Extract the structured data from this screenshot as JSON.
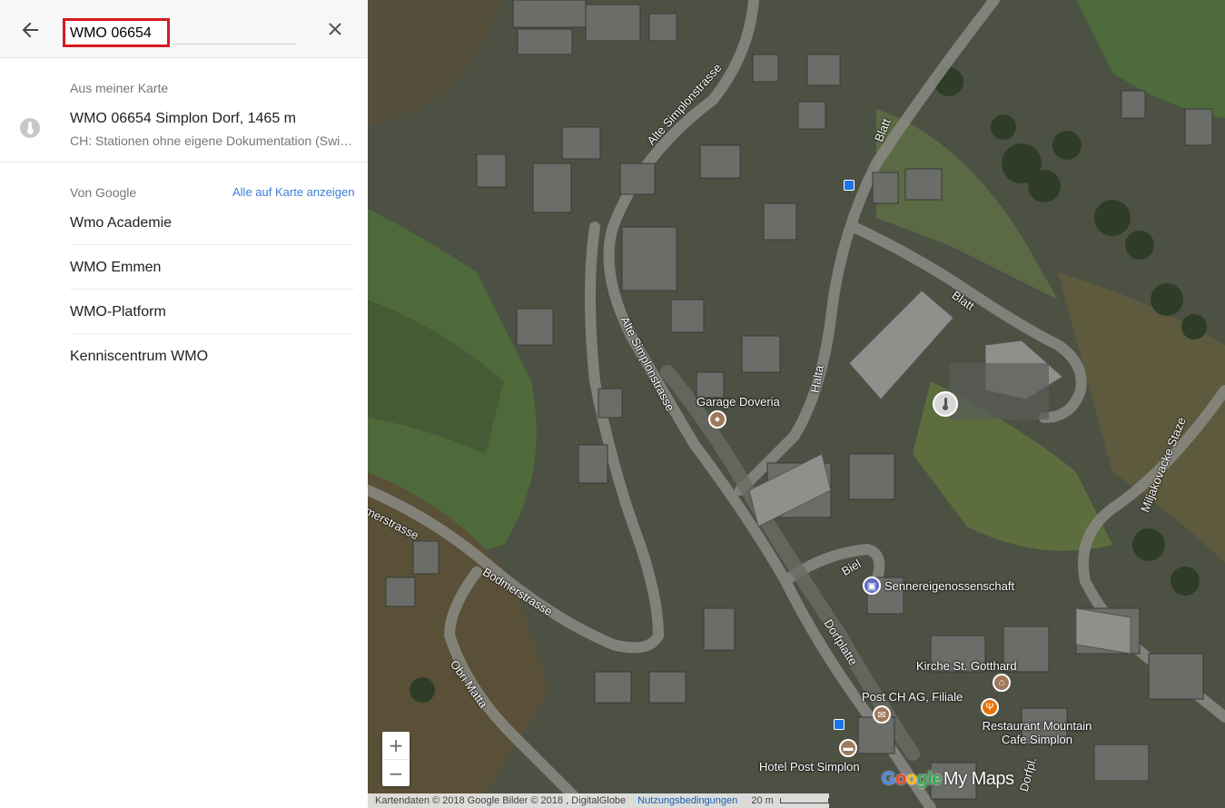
{
  "search": {
    "query": "WMO 06654",
    "back_icon": "arrow-left-icon",
    "close_icon": "close-icon"
  },
  "my_map": {
    "section_label": "Aus meiner Karte",
    "result_title": "WMO 06654 Simplon Dorf, 1465 m",
    "result_subtitle": "CH: Stationen ohne eigene Dokumentation (Swis…",
    "result_icon": "thermometer-icon"
  },
  "google": {
    "section_label": "Von Google",
    "show_all_link": "Alle auf Karte anzeigen",
    "results": [
      "Wmo Academie",
      "WMO Emmen",
      "WMO-Platform",
      "Kenniscentrum WMO"
    ]
  },
  "map": {
    "streets": [
      "Alte Simplonstrasse",
      "Alte Simplonstrasse",
      "Blatt",
      "Blatt",
      "Halta",
      "merstrasse",
      "Bodmerstrasse",
      "Obri Matta",
      "Biel",
      "Dorfplatte",
      "Miljakovacke Staze",
      "Dorfpl."
    ],
    "pois": [
      {
        "name": "Garage Doveria",
        "icon": "pin-icon",
        "color": "#a0785a"
      },
      {
        "name": "Sennereigenossenschaft",
        "icon": "shopping-bag-icon",
        "color": "#5c6bc0"
      },
      {
        "name": "Kirche St. Gotthard",
        "icon": "church-icon",
        "color": "#a0785a"
      },
      {
        "name": "Restaurant Mountain Cafe Simplon",
        "icon": "fork-knife-icon",
        "color": "#e8710a"
      },
      {
        "name": "Post CH AG, Filiale",
        "icon": "mail-icon",
        "color": "#a0785a"
      },
      {
        "name": "Hotel Post Simplon",
        "icon": "bed-icon",
        "color": "#a0785a"
      }
    ],
    "zoom_in": "+",
    "zoom_out": "−",
    "footer": {
      "attribution": "Kartendaten © 2018 Google Bilder © 2018 , DigitalGlobe",
      "terms": "Nutzungsbedingungen",
      "scale": "20 m"
    },
    "logo": {
      "g1": "G",
      "g2": "o",
      "g3": "o",
      "g4": "gle",
      "suffix": "My Maps"
    }
  }
}
